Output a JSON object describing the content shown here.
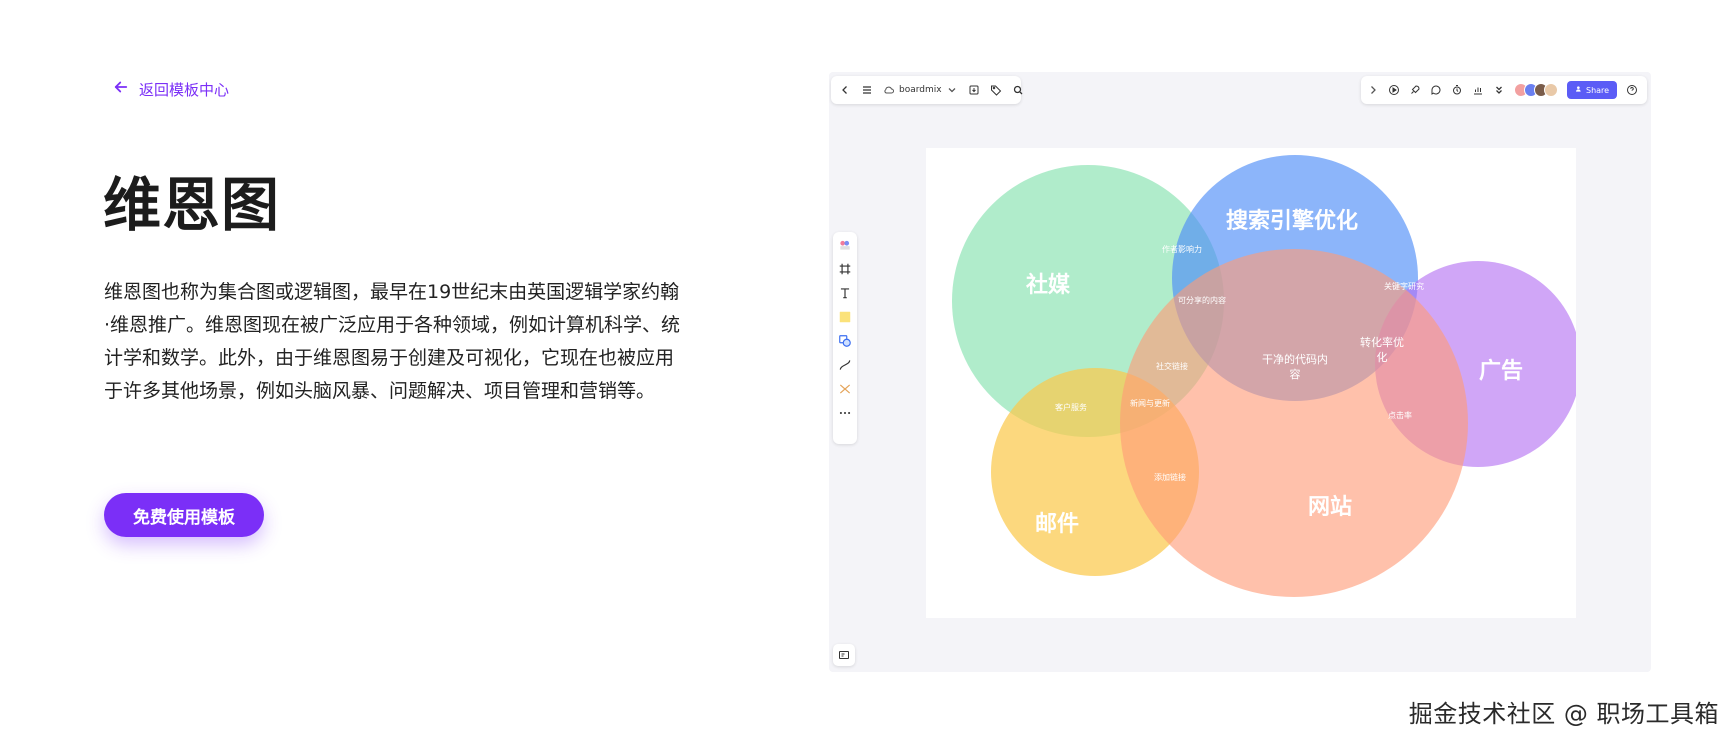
{
  "back_link": {
    "label": "返回模板中心"
  },
  "title": "维恩图",
  "description": "维恩图也称为集合图或逻辑图，最早在19世纪末由英国逻辑学家约翰·维恩推广。维恩图现在被广泛应用于各种领域，例如计算机科学、统计学和数学。此外，由于维恩图易于创建及可视化，它现在也被应用于许多其他场景，例如头脑风暴、问题解决、项目管理和营销等。",
  "cta": {
    "label": "免费使用模板"
  },
  "preview": {
    "toolbar": {
      "brand": "boardmix",
      "share_label": "Share"
    },
    "venn": {
      "sets": [
        {
          "label": "社媒",
          "color": "#6fdca0"
        },
        {
          "label": "搜索引擎优化",
          "color": "#4f8ef7"
        },
        {
          "label": "广告",
          "color": "#b36ff2"
        },
        {
          "label": "邮件",
          "color": "#fbc94c"
        },
        {
          "label": "网站",
          "color": "#ff9b78"
        }
      ],
      "intersections": {
        "author_influence": "作者影响力",
        "shareable": "可分享的内容",
        "keyword": "关键字研究",
        "clean_code_1": "干净的代码内",
        "clean_code_2": "容",
        "conversion_1": "转化率优",
        "conversion_2": "化",
        "social_links": "社交链接",
        "customer_service": "客户服务",
        "news": "新闻与更新",
        "ctr": "点击率",
        "add_ads": "添加链接"
      }
    }
  },
  "watermark": "掘金技术社区 @ 职场工具箱"
}
